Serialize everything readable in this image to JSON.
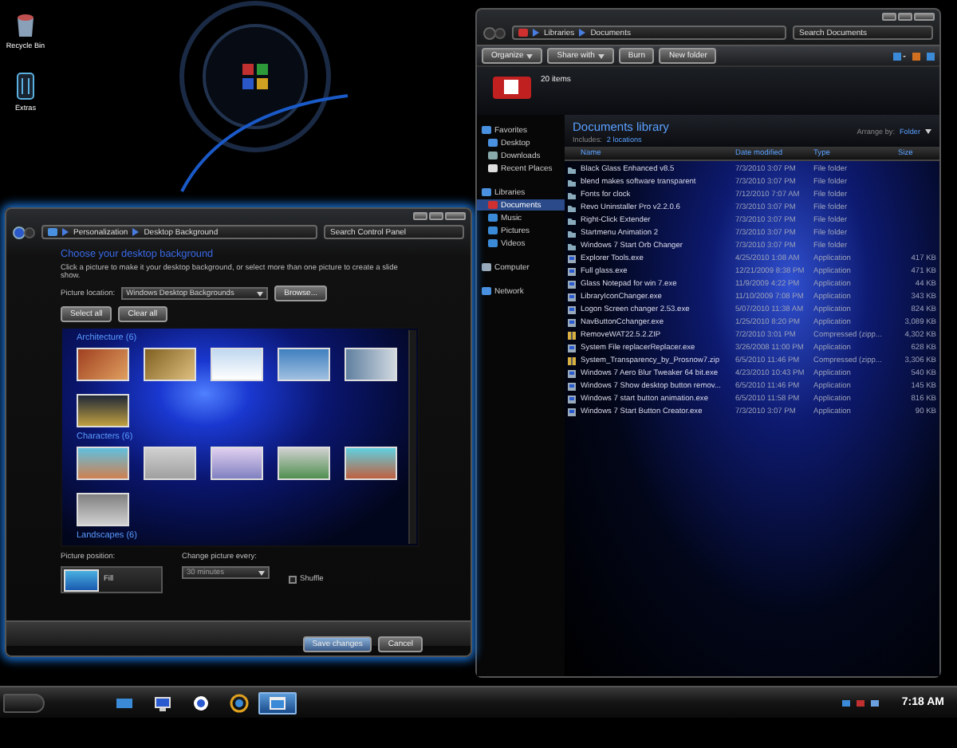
{
  "desktop_icons": [
    {
      "label": "Recycle Bin",
      "kind": "bin"
    },
    {
      "label": "Extras",
      "kind": "folder"
    }
  ],
  "explorer": {
    "breadcrumb": [
      "Libraries",
      "Documents"
    ],
    "search": {
      "placeholder": "Search Documents"
    },
    "toolbar": [
      {
        "label": "Organize",
        "dropdown": true
      },
      {
        "label": "Share with",
        "dropdown": true
      },
      {
        "label": "Burn",
        "dropdown": false
      },
      {
        "label": "New folder",
        "dropdown": false
      }
    ],
    "item_count": "20 items",
    "nav": [
      {
        "label": "Favorites",
        "kind": "star",
        "selected": false,
        "children": [
          {
            "label": "Desktop",
            "kind": "desktop",
            "selected": false
          },
          {
            "label": "Downloads",
            "kind": "download",
            "selected": false
          },
          {
            "label": "Recent Places",
            "kind": "recent",
            "selected": false
          }
        ]
      },
      {
        "label": "Libraries",
        "kind": "library",
        "selected": false,
        "children": [
          {
            "label": "Documents",
            "kind": "doc",
            "selected": true
          },
          {
            "label": "Music",
            "kind": "music",
            "selected": false
          },
          {
            "label": "Pictures",
            "kind": "picture",
            "selected": false
          },
          {
            "label": "Videos",
            "kind": "video",
            "selected": false
          }
        ]
      },
      {
        "label": "Computer",
        "kind": "computer",
        "selected": false
      },
      {
        "label": "Network",
        "kind": "network",
        "selected": false
      }
    ],
    "library_title": "Documents library",
    "includes_label": "Includes:",
    "includes_link": "2 locations",
    "arrange_label": "Arrange by:",
    "arrange_value": "Folder",
    "columns": [
      "Name",
      "Date modified",
      "Type",
      "Size"
    ],
    "files": [
      {
        "kind": "folder",
        "name": "Black Glass Enhanced v8.5",
        "date": "7/3/2010 3:07 PM",
        "type": "File folder"
      },
      {
        "kind": "folder",
        "name": "blend makes software transparent",
        "date": "7/3/2010 3:07 PM",
        "type": "File folder"
      },
      {
        "kind": "folder",
        "name": "Fonts for clock",
        "date": "7/12/2010 7:07 AM",
        "type": "File folder"
      },
      {
        "kind": "folder",
        "name": "Revo Uninstaller Pro v2.2.0.6",
        "date": "7/3/2010 3:07 PM",
        "type": "File folder"
      },
      {
        "kind": "folder",
        "name": "Right-Click Extender",
        "date": "7/3/2010 3:07 PM",
        "type": "File folder"
      },
      {
        "kind": "folder",
        "name": "Startmenu Animation 2",
        "date": "7/3/2010 3:07 PM",
        "type": "File folder"
      },
      {
        "kind": "folder",
        "name": "Windows 7 Start Orb Changer",
        "date": "7/3/2010 3:07 PM",
        "type": "File folder"
      },
      {
        "kind": "app",
        "name": "Explorer Tools.exe",
        "date": "4/25/2010 1:08 AM",
        "type": "Application",
        "size": "417 KB"
      },
      {
        "kind": "app",
        "name": "Full glass.exe",
        "date": "12/21/2009 8:38 PM",
        "type": "Application",
        "size": "471 KB"
      },
      {
        "kind": "app",
        "name": "Glass Notepad for win 7.exe",
        "date": "11/9/2009 4:22 PM",
        "type": "Application",
        "size": "44 KB"
      },
      {
        "kind": "app",
        "name": "LibraryIconChanger.exe",
        "date": "11/10/2009 7:08 PM",
        "type": "Application",
        "size": "343 KB"
      },
      {
        "kind": "app",
        "name": "Logon Screen changer 2.53.exe",
        "date": "5/07/2010 11:38 AM",
        "type": "Application",
        "size": "824 KB"
      },
      {
        "kind": "app",
        "name": "NavButtonCchanger.exe",
        "date": "1/25/2010 8:20 PM",
        "type": "Application",
        "size": "3,089 KB"
      },
      {
        "kind": "zip",
        "name": "RemoveWAT22.5.2.ZIP",
        "date": "7/2/2010 3:01 PM",
        "type": "Compressed (zipp...",
        "size": "4,302 KB"
      },
      {
        "kind": "app",
        "name": "System File replacerReplacer.exe",
        "date": "3/26/2008 11:00 PM",
        "type": "Application",
        "size": "628 KB"
      },
      {
        "kind": "zip",
        "name": "System_Transparency_by_Prosnow7.zip",
        "date": "6/5/2010 11:46 PM",
        "type": "Compressed (zipp...",
        "size": "3,306 KB"
      },
      {
        "kind": "app",
        "name": "Windows 7 Aero Blur Tweaker 64 bit.exe",
        "date": "4/23/2010 10:43 PM",
        "type": "Application",
        "size": "540 KB"
      },
      {
        "kind": "app",
        "name": "Windows 7 Show desktop button remov...",
        "date": "6/5/2010 11:46 PM",
        "type": "Application",
        "size": "145 KB"
      },
      {
        "kind": "app",
        "name": "Windows 7 start button animation.exe",
        "date": "6/5/2010 11:58 PM",
        "type": "Application",
        "size": "816 KB"
      },
      {
        "kind": "app",
        "name": "Windows 7 Start Button Creator.exe",
        "date": "7/3/2010 3:07 PM",
        "type": "Application",
        "size": "90 KB"
      }
    ]
  },
  "personalization": {
    "breadcrumb": [
      "Personalization",
      "Desktop Background"
    ],
    "search": {
      "placeholder": "Search Control Panel"
    },
    "heading": "Choose your desktop background",
    "description": "Click a picture to make it your desktop background, or select more than one picture to create a slide show.",
    "location_label": "Picture location:",
    "location_value": "Windows Desktop Backgrounds",
    "browse": "Browse...",
    "select_all": "Select all",
    "clear_all": "Clear all",
    "groups": [
      {
        "title": "Architecture (6)",
        "thumbnails": [
          {
            "kind": "photo"
          },
          {
            "kind": "photo"
          },
          {
            "kind": "photo"
          },
          {
            "kind": "photo"
          },
          {
            "kind": "photo"
          },
          {
            "kind": "photo"
          }
        ]
      },
      {
        "title": "Characters (6)",
        "thumbnails": [
          {
            "kind": "photo"
          },
          {
            "kind": "photo"
          },
          {
            "kind": "photo"
          },
          {
            "kind": "photo"
          },
          {
            "kind": "photo"
          },
          {
            "kind": "photo"
          }
        ]
      },
      {
        "title": "Landscapes (6)"
      }
    ],
    "position_label": "Picture position:",
    "position_value": "Fill",
    "interval_label": "Change picture every:",
    "interval_value": "30 minutes",
    "interval_disabled": true,
    "shuffle": {
      "label": "Shuffle",
      "checked": false
    },
    "buttons": [
      "Save changes",
      "Cancel"
    ]
  },
  "taskbar": {
    "items": [
      {
        "kind": "desktop",
        "selected": false
      },
      {
        "kind": "monitor",
        "selected": false
      },
      {
        "kind": "media",
        "selected": false
      },
      {
        "kind": "pinwheel",
        "selected": false
      },
      {
        "kind": "window",
        "selected": true
      }
    ],
    "tray": [
      {
        "kind": "network"
      },
      {
        "kind": "flag"
      },
      {
        "kind": "volume"
      }
    ],
    "clock": "7:18 AM"
  }
}
